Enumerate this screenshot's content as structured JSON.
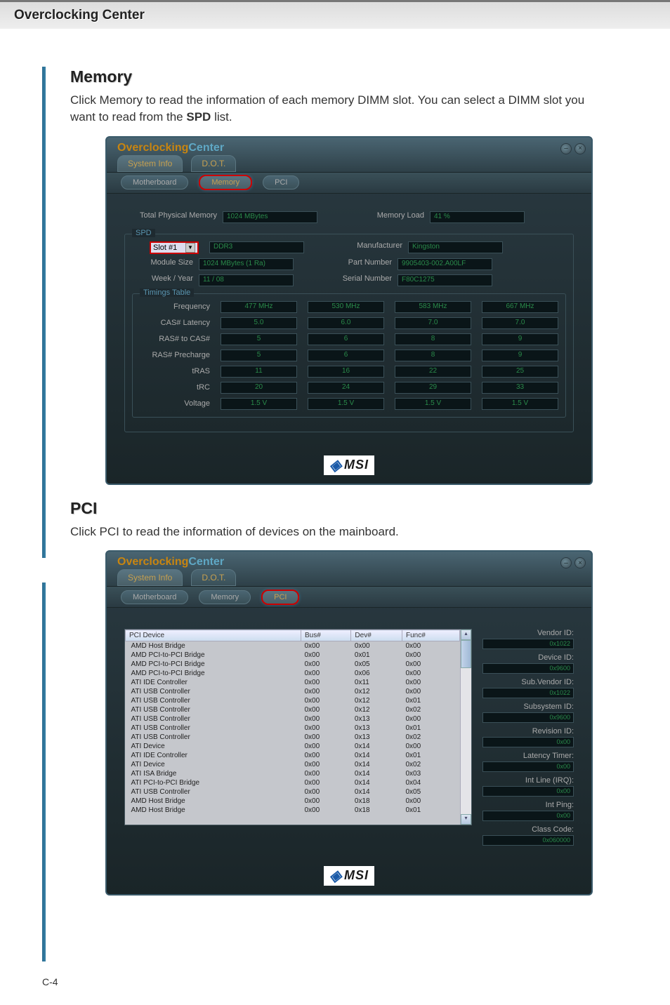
{
  "sectionTitle": "Overclocking Center",
  "memory": {
    "heading": "Memory",
    "bodyPrefix": "Click Memory to read the information of each memory DIMM slot. You can select a DIMM slot you want to read from the ",
    "bodyStrong": "SPD",
    "bodySuffix": " list."
  },
  "pci": {
    "heading": "PCI",
    "body": "Click PCI to read the information of devices on the mainboard."
  },
  "app": {
    "logoOc": "Overclocking",
    "logoCn": "Center",
    "mainTabs": {
      "sysinfo": "System Info",
      "dot": "D.O.T."
    },
    "subTabs": {
      "motherboard": "Motherboard",
      "memory": "Memory",
      "pci": "PCI"
    }
  },
  "memWindow": {
    "totalPhysLabel": "Total Physical Memory",
    "totalPhysVal": "1024 MBytes",
    "memLoadLabel": "Memory Load",
    "memLoadVal": "41 %",
    "spdLegend": "SPD",
    "slotLabel": "Slot #1",
    "typeVal": "DDR3",
    "manufacturerLabel": "Manufacturer",
    "manufacturerVal": "Kingston",
    "moduleSizeLabel": "Module Size",
    "moduleSizeVal": "1024 MBytes (1 Ra)",
    "partNumberLabel": "Part Number",
    "partNumberVal": "9905403-002.A00LF",
    "weekYearLabel": "Week / Year",
    "weekYearVal": "11 / 08",
    "serialNumberLabel": "Serial Number",
    "serialNumberVal": "F80C1275",
    "timingsLegend": "Timings Table",
    "timingRows": [
      {
        "label": "Frequency",
        "v": [
          "477 MHz",
          "530 MHz",
          "583 MHz",
          "667 MHz"
        ]
      },
      {
        "label": "CAS# Latency",
        "v": [
          "5.0",
          "6.0",
          "7.0",
          "7.0"
        ]
      },
      {
        "label": "RAS# to CAS#",
        "v": [
          "5",
          "6",
          "8",
          "9"
        ]
      },
      {
        "label": "RAS# Precharge",
        "v": [
          "5",
          "6",
          "8",
          "9"
        ]
      },
      {
        "label": "tRAS",
        "v": [
          "11",
          "16",
          "22",
          "25"
        ]
      },
      {
        "label": "tRC",
        "v": [
          "20",
          "24",
          "29",
          "33"
        ]
      },
      {
        "label": "Voltage",
        "v": [
          "1.5 V",
          "1.5 V",
          "1.5 V",
          "1.5 V"
        ]
      }
    ]
  },
  "pciWindow": {
    "headers": [
      "PCI Device",
      "Bus#",
      "Dev#",
      "Func#"
    ],
    "rows": [
      [
        "AMD Host Bridge",
        "0x00",
        "0x00",
        "0x00"
      ],
      [
        "AMD PCI-to-PCI Bridge",
        "0x00",
        "0x01",
        "0x00"
      ],
      [
        "AMD PCI-to-PCI Bridge",
        "0x00",
        "0x05",
        "0x00"
      ],
      [
        "AMD PCI-to-PCI Bridge",
        "0x00",
        "0x06",
        "0x00"
      ],
      [
        "ATI IDE Controller",
        "0x00",
        "0x11",
        "0x00"
      ],
      [
        "ATI USB Controller",
        "0x00",
        "0x12",
        "0x00"
      ],
      [
        "ATI USB Controller",
        "0x00",
        "0x12",
        "0x01"
      ],
      [
        "ATI USB Controller",
        "0x00",
        "0x12",
        "0x02"
      ],
      [
        "ATI USB Controller",
        "0x00",
        "0x13",
        "0x00"
      ],
      [
        "ATI USB Controller",
        "0x00",
        "0x13",
        "0x01"
      ],
      [
        "ATI USB Controller",
        "0x00",
        "0x13",
        "0x02"
      ],
      [
        "ATI Device",
        "0x00",
        "0x14",
        "0x00"
      ],
      [
        "ATI IDE Controller",
        "0x00",
        "0x14",
        "0x01"
      ],
      [
        "ATI Device",
        "0x00",
        "0x14",
        "0x02"
      ],
      [
        "ATI ISA Bridge",
        "0x00",
        "0x14",
        "0x03"
      ],
      [
        "ATI PCI-to-PCI Bridge",
        "0x00",
        "0x14",
        "0x04"
      ],
      [
        "ATI USB Controller",
        "0x00",
        "0x14",
        "0x05"
      ],
      [
        "AMD Host Bridge",
        "0x00",
        "0x18",
        "0x00"
      ],
      [
        "AMD Host Bridge",
        "0x00",
        "0x18",
        "0x01"
      ]
    ],
    "details": [
      {
        "label": "Vendor ID:",
        "val": "0x1022"
      },
      {
        "label": "Device ID:",
        "val": "0x9600"
      },
      {
        "label": "Sub.Vendor ID:",
        "val": "0x1022"
      },
      {
        "label": "Subsystem ID:",
        "val": "0x9600"
      },
      {
        "label": "Revision ID:",
        "val": "0x00"
      },
      {
        "label": "Latency Timer:",
        "val": "0x00"
      },
      {
        "label": "Int Line (IRQ):",
        "val": "0x00"
      },
      {
        "label": "Int Ping:",
        "val": "0x00"
      },
      {
        "label": "Class Code:",
        "val": "0x060000"
      }
    ]
  },
  "logoText": "MSI",
  "pageNumber": "C-4"
}
